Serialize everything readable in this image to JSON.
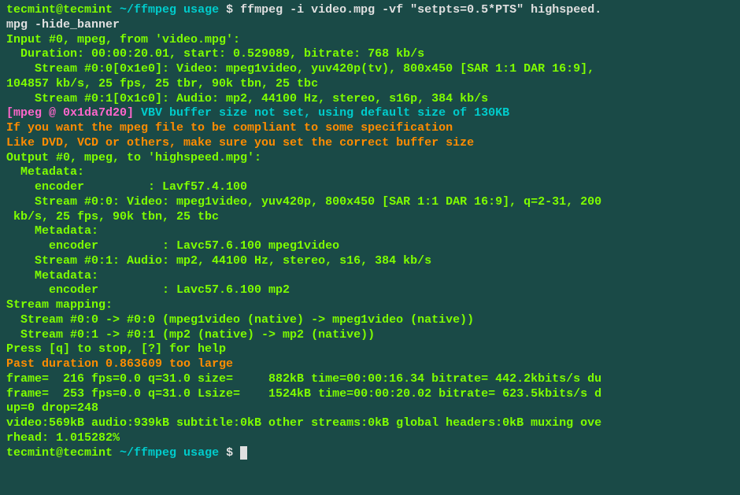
{
  "prompt": {
    "user": "tecmint@tecmint",
    "path": "~/ffmpeg usage",
    "dollar": "$",
    "command": "ffmpeg -i video.mpg -vf \"setpts=0.5*PTS\" highspeed.",
    "command_line2": "mpg -hide_banner"
  },
  "output": {
    "input_header": "Input #0, mpeg, from 'video.mpg':",
    "duration": "  Duration: 00:00:20.01, start: 0.529089, bitrate: 768 kb/s",
    "stream0_0a": "    Stream #0:0[0x1e0]: Video: mpeg1video, yuv420p(tv), 800x450 [SAR 1:1 DAR 16:9], ",
    "stream0_0b": "104857 kb/s, 25 fps, 25 tbr, 90k tbn, 25 tbc",
    "stream0_1": "    Stream #0:1[0x1c0]: Audio: mp2, 44100 Hz, stereo, s16p, 384 kb/s",
    "vbv_tag": "[mpeg @ 0x1da7d20] ",
    "vbv_msg": "VBV buffer size not set, using default size of 130KB",
    "warn1": "If you want the mpeg file to be compliant to some specification",
    "warn2": "Like DVD, VCD or others, make sure you set the correct buffer size",
    "output_header": "Output #0, mpeg, to 'highspeed.mpg':",
    "metadata1": "  Metadata:",
    "encoder1": "    encoder         : Lavf57.4.100",
    "out_stream0a": "    Stream #0:0: Video: mpeg1video, yuv420p, 800x450 [SAR 1:1 DAR 16:9], q=2-31, 200",
    "out_stream0b": " kb/s, 25 fps, 90k tbn, 25 tbc",
    "metadata2": "    Metadata:",
    "encoder2": "      encoder         : Lavc57.6.100 mpeg1video",
    "out_stream1": "    Stream #0:1: Audio: mp2, 44100 Hz, stereo, s16, 384 kb/s",
    "metadata3": "    Metadata:",
    "encoder3": "      encoder         : Lavc57.6.100 mp2",
    "stream_mapping": "Stream mapping:",
    "map0": "  Stream #0:0 -> #0:0 (mpeg1video (native) -> mpeg1video (native))",
    "map1": "  Stream #0:1 -> #0:1 (mp2 (native) -> mp2 (native))",
    "press": "Press [q] to stop, [?] for help",
    "past_duration": "Past duration 0.863609 too large",
    "frame1": "frame=  216 fps=0.0 q=31.0 size=     882kB time=00:00:16.34 bitrate= 442.2kbits/s du",
    "frame2": "frame=  253 fps=0.0 q=31.0 Lsize=    1524kB time=00:00:20.02 bitrate= 623.5kbits/s d",
    "frame3": "up=0 drop=248",
    "video_line1": "video:569kB audio:939kB subtitle:0kB other streams:0kB global headers:0kB muxing ove",
    "video_line2": "rhead: 1.015282%"
  },
  "prompt2": {
    "user": "tecmint@tecmint",
    "path": "~/ffmpeg usage",
    "dollar": "$"
  }
}
